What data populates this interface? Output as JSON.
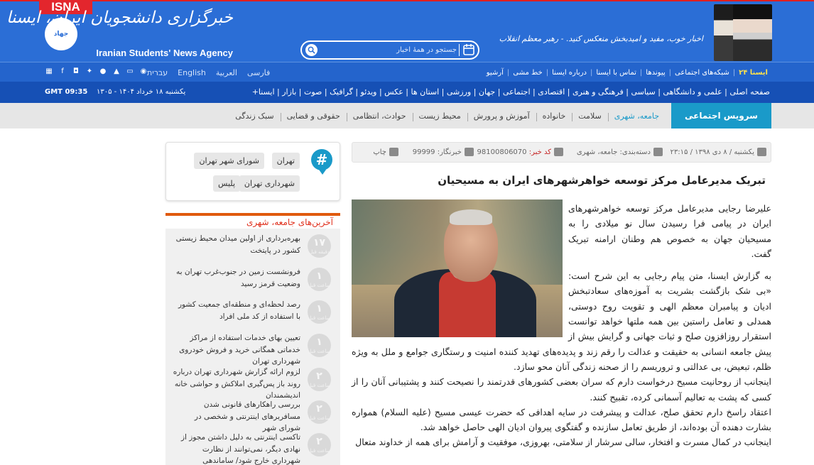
{
  "header": {
    "isna_tag": "ISNA",
    "logo_fa": "خبرگزاری دانشجویان ایران، ایسنا",
    "logo_en": "Iranian Students' News Agency",
    "search_placeholder": "جستجو در همهٔ اخبار",
    "slogan": "اخبار خوب، مفید و امیدبخش منعکس کنید. - رهبر معظم انقلاب",
    "emblem": "جهاد دانشگاهی"
  },
  "nav1": {
    "links": [
      "آرشیو",
      "خط مشی",
      "درباره ایسنا",
      "تماس با ایسنا",
      "پیوندها",
      "شبکه‌های اجتماعی",
      "ایسنا ۲۴"
    ],
    "languages": [
      "فارسی",
      "العربية",
      "English",
      "עברית"
    ],
    "social_icons": [
      "apps-icon",
      "facebook-icon",
      "instagram-icon",
      "twitter-icon",
      "apple-icon",
      "android-icon",
      "desktop-icon",
      "rss-icon"
    ]
  },
  "nav2": {
    "categories": "صفحه اصلی | علمی و دانشگاهی | سیاسی | فرهنگی و هنری | اقتصادی | اجتماعی | جهان | ورزشی | استان ها | عکس | ویدئو | گرافیک | صوت | بازار | ایسنا+",
    "date": "یکشنبه ۱۸ خرداد ۱۴۰۴ - ۱۳۰۵",
    "time": "GMT 09:35"
  },
  "service": {
    "title": "سرویس اجتماعی",
    "items": [
      "جامعه، شهری",
      "سلامت",
      "خانواده",
      "آموزش و پرورش",
      "محیط زیست",
      "حوادث، انتظامی",
      "حقوقی و قضایی",
      "سبک زندگی"
    ],
    "active_index": 0
  },
  "meta": {
    "date": "یکشنبه / ۸ دی ۱۳۹۸ / ۲۳:۱۵",
    "category_label": "دسته‌بندی: جامعه، شهری",
    "code_label": "کد خبر:",
    "code": "98100806070",
    "reporter_label": "خبرنگار:",
    "reporter": "99999",
    "print": "چاپ"
  },
  "article": {
    "title": "تبریک مدیرعامل مرکز توسعه خواهرشهرهای ایران به مسیحیان",
    "lead": "علیرضا رجایی مدیرعامل مرکز توسعه خواهرشهرهای ایران در پیامی فرا رسیدن سال نو میلادی را به مسیحیان جهان به خصوص هم وطنان ارامنه تبریک گفت.",
    "p1": "به گزارش ایسنا، متن پیام رجایی به این شرح است: «بی شک بازگشت بشریت به آموزه‌های سعادتبخش ادیان و پیامبران معظم الهی و تقویت روح دوستی، همدلی و تعامل راستین بین همه ملتها خواهد توانست استقرار روزافزون صلح و ثبات جهانی و گرایش بیش از پیش جامعه انسانی به حقیقت و عدالت را رقم زند و پدیده‌های تهدید کننده امنیت و رستگاری جوامع و ملل به ویژه ظلم، تبعیض، بی عدالتی و تروریسم را از صحنه زندگی آنان محو سازد.",
    "p2": "اینجانب از روحانیت مسیح درخواست دارم که سران بعضی کشورهای قدرتمند را نصیحت کنند و پشتیبانی آنان را از کسی که پشت به تعالیم آسمانی کرده، تقبیح کنند.",
    "p3": "اعتقاد راسخ دارم تحقق صلح، عدالت و پیشرفت در سایه اهدافی که حضرت عیسی مسیح (علیه السلام) همواره بشارت دهنده آن بوده‌اند، از طریق تعامل سازنده و گفتگوی پیروان ادیان الهی حاصل خواهد شد.",
    "p4": "اینجانب در کمال مسرت و افتخار، سالی سرشار از سلامتی، بهروزی، موفقیت و آرامش برای همه از خداوند متعال"
  },
  "tags": [
    "تهران",
    "شورای شهر تهران",
    "شهرداری تهران",
    "پلیس"
  ],
  "latest": {
    "title": "آخرین‌های جامعه، شهری",
    "items": [
      {
        "num": "۱۷",
        "unit": "دقیقه قبل",
        "text": "بهره‌برداری از اولین میدان محیط زیستی کشور در پایتخت"
      },
      {
        "num": "۱",
        "unit": "ساعت قبل",
        "text": "فرونشست زمین در جنوب‌غرب تهران به وضعیت قرمز رسید"
      },
      {
        "num": "۱",
        "unit": "ساعت قبل",
        "text": "رصد لحظه‌ای و منطقه‌ای جمعیت کشور با استفاده از کد ملی افراد"
      },
      {
        "num": "۱",
        "unit": "ساعت قبل",
        "text": "تعیین بهای خدمات استفاده از مراکز خدماتی همگانی خرید و فروش خودروی شهرداری تهران"
      },
      {
        "num": "۲",
        "unit": "ساعت قبل",
        "text": "لزوم ارائه گزارش شهرداری تهران درباره روند باز پس‌گیری املاکش و حواشی خانه اندیشمندان"
      },
      {
        "num": "۲",
        "unit": "ساعت قبل",
        "text": "بررسی راهکارهای قانونی شدن مسافربرهای اینترنتی و شخصی در شورای شهر"
      },
      {
        "num": "۲",
        "unit": "ساعت قبل",
        "text": "تاکسی اینترنتی به دلیل داشتن مجوز از نهادی دیگر، نمی‌توانند از نظارت شهرداری خارج شود/ ساماندهی مسافربرهای شخصی"
      }
    ]
  },
  "colors": {
    "header_blue": "#2b6ed6",
    "nav_blue": "#1650b5",
    "accent_cyan": "#1a9ac9",
    "accent_orange": "#e05a0d",
    "isna_red": "#e3262d"
  }
}
